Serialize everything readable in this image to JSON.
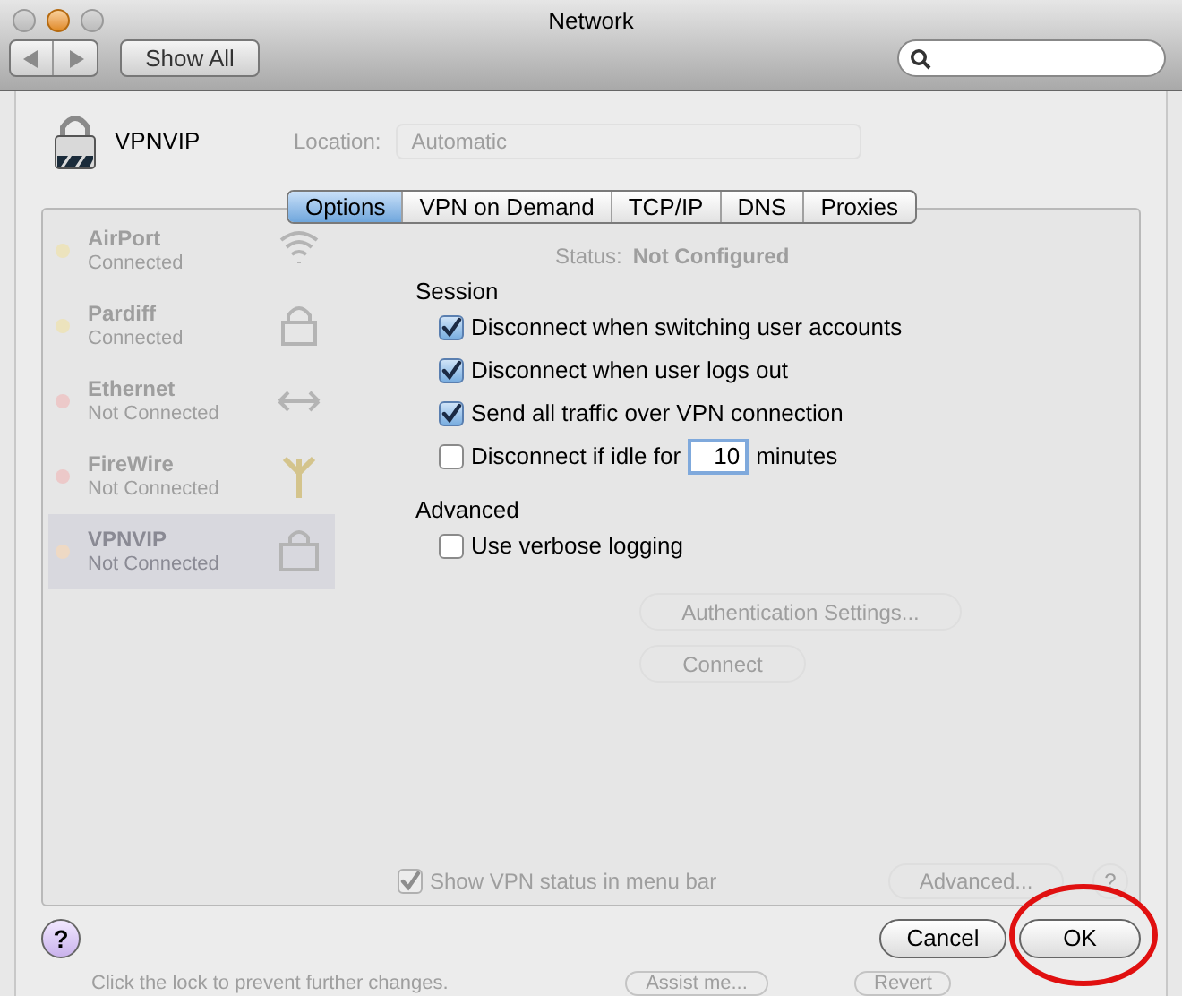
{
  "window": {
    "title": "Network"
  },
  "toolbar": {
    "show_all": "Show All"
  },
  "service": {
    "name": "VPNVIP"
  },
  "tabs": [
    {
      "label": "Options",
      "selected": true
    },
    {
      "label": "VPN on Demand",
      "selected": false
    },
    {
      "label": "TCP/IP",
      "selected": false
    },
    {
      "label": "DNS",
      "selected": false
    },
    {
      "label": "Proxies",
      "selected": false
    }
  ],
  "options": {
    "sections": [
      {
        "title": "Session",
        "items": [
          {
            "kind": "checkbox",
            "label": "Disconnect when switching user accounts",
            "checked": true
          },
          {
            "kind": "checkbox",
            "label": "Disconnect when user logs out",
            "checked": true
          },
          {
            "kind": "checkbox",
            "label": "Send all traffic over VPN connection",
            "checked": true
          },
          {
            "kind": "idle",
            "label": "Disconnect if idle for",
            "value": "10",
            "unit": "minutes",
            "checked": false
          }
        ]
      },
      {
        "title": "Advanced",
        "items": [
          {
            "kind": "checkbox",
            "label": "Use verbose logging",
            "checked": false
          }
        ]
      }
    ]
  },
  "buttons": {
    "help": "?",
    "cancel": "Cancel",
    "ok": "OK"
  },
  "background": {
    "location_label": "Location:",
    "location_value": "Automatic",
    "services": [
      {
        "name": "AirPort",
        "status": "Connected",
        "color": "#ece3bd",
        "selected": false
      },
      {
        "name": "Pardiff",
        "status": "Connected",
        "color": "#ece3bd",
        "selected": false
      },
      {
        "name": "Ethernet",
        "status": "Not Connected",
        "color": "#ecc9c9",
        "selected": false
      },
      {
        "name": "FireWire",
        "status": "Not Connected",
        "color": "#ecc9c9",
        "selected": false
      },
      {
        "name": "VPNVIP",
        "status": "Not Connected",
        "color": "#eed9c4",
        "selected": true
      }
    ],
    "status_label": "Status:",
    "status_value": "Not Configured",
    "authentication_button": "Authentication Settings...",
    "connect_button": "Connect",
    "show_status": {
      "label": "Show VPN status in menu bar",
      "checked": true
    },
    "advanced_button": "Advanced...",
    "help": "?",
    "lock_text": "Click the lock to prevent further changes.",
    "assist_button": "Assist me...",
    "revert_button": "Revert"
  }
}
